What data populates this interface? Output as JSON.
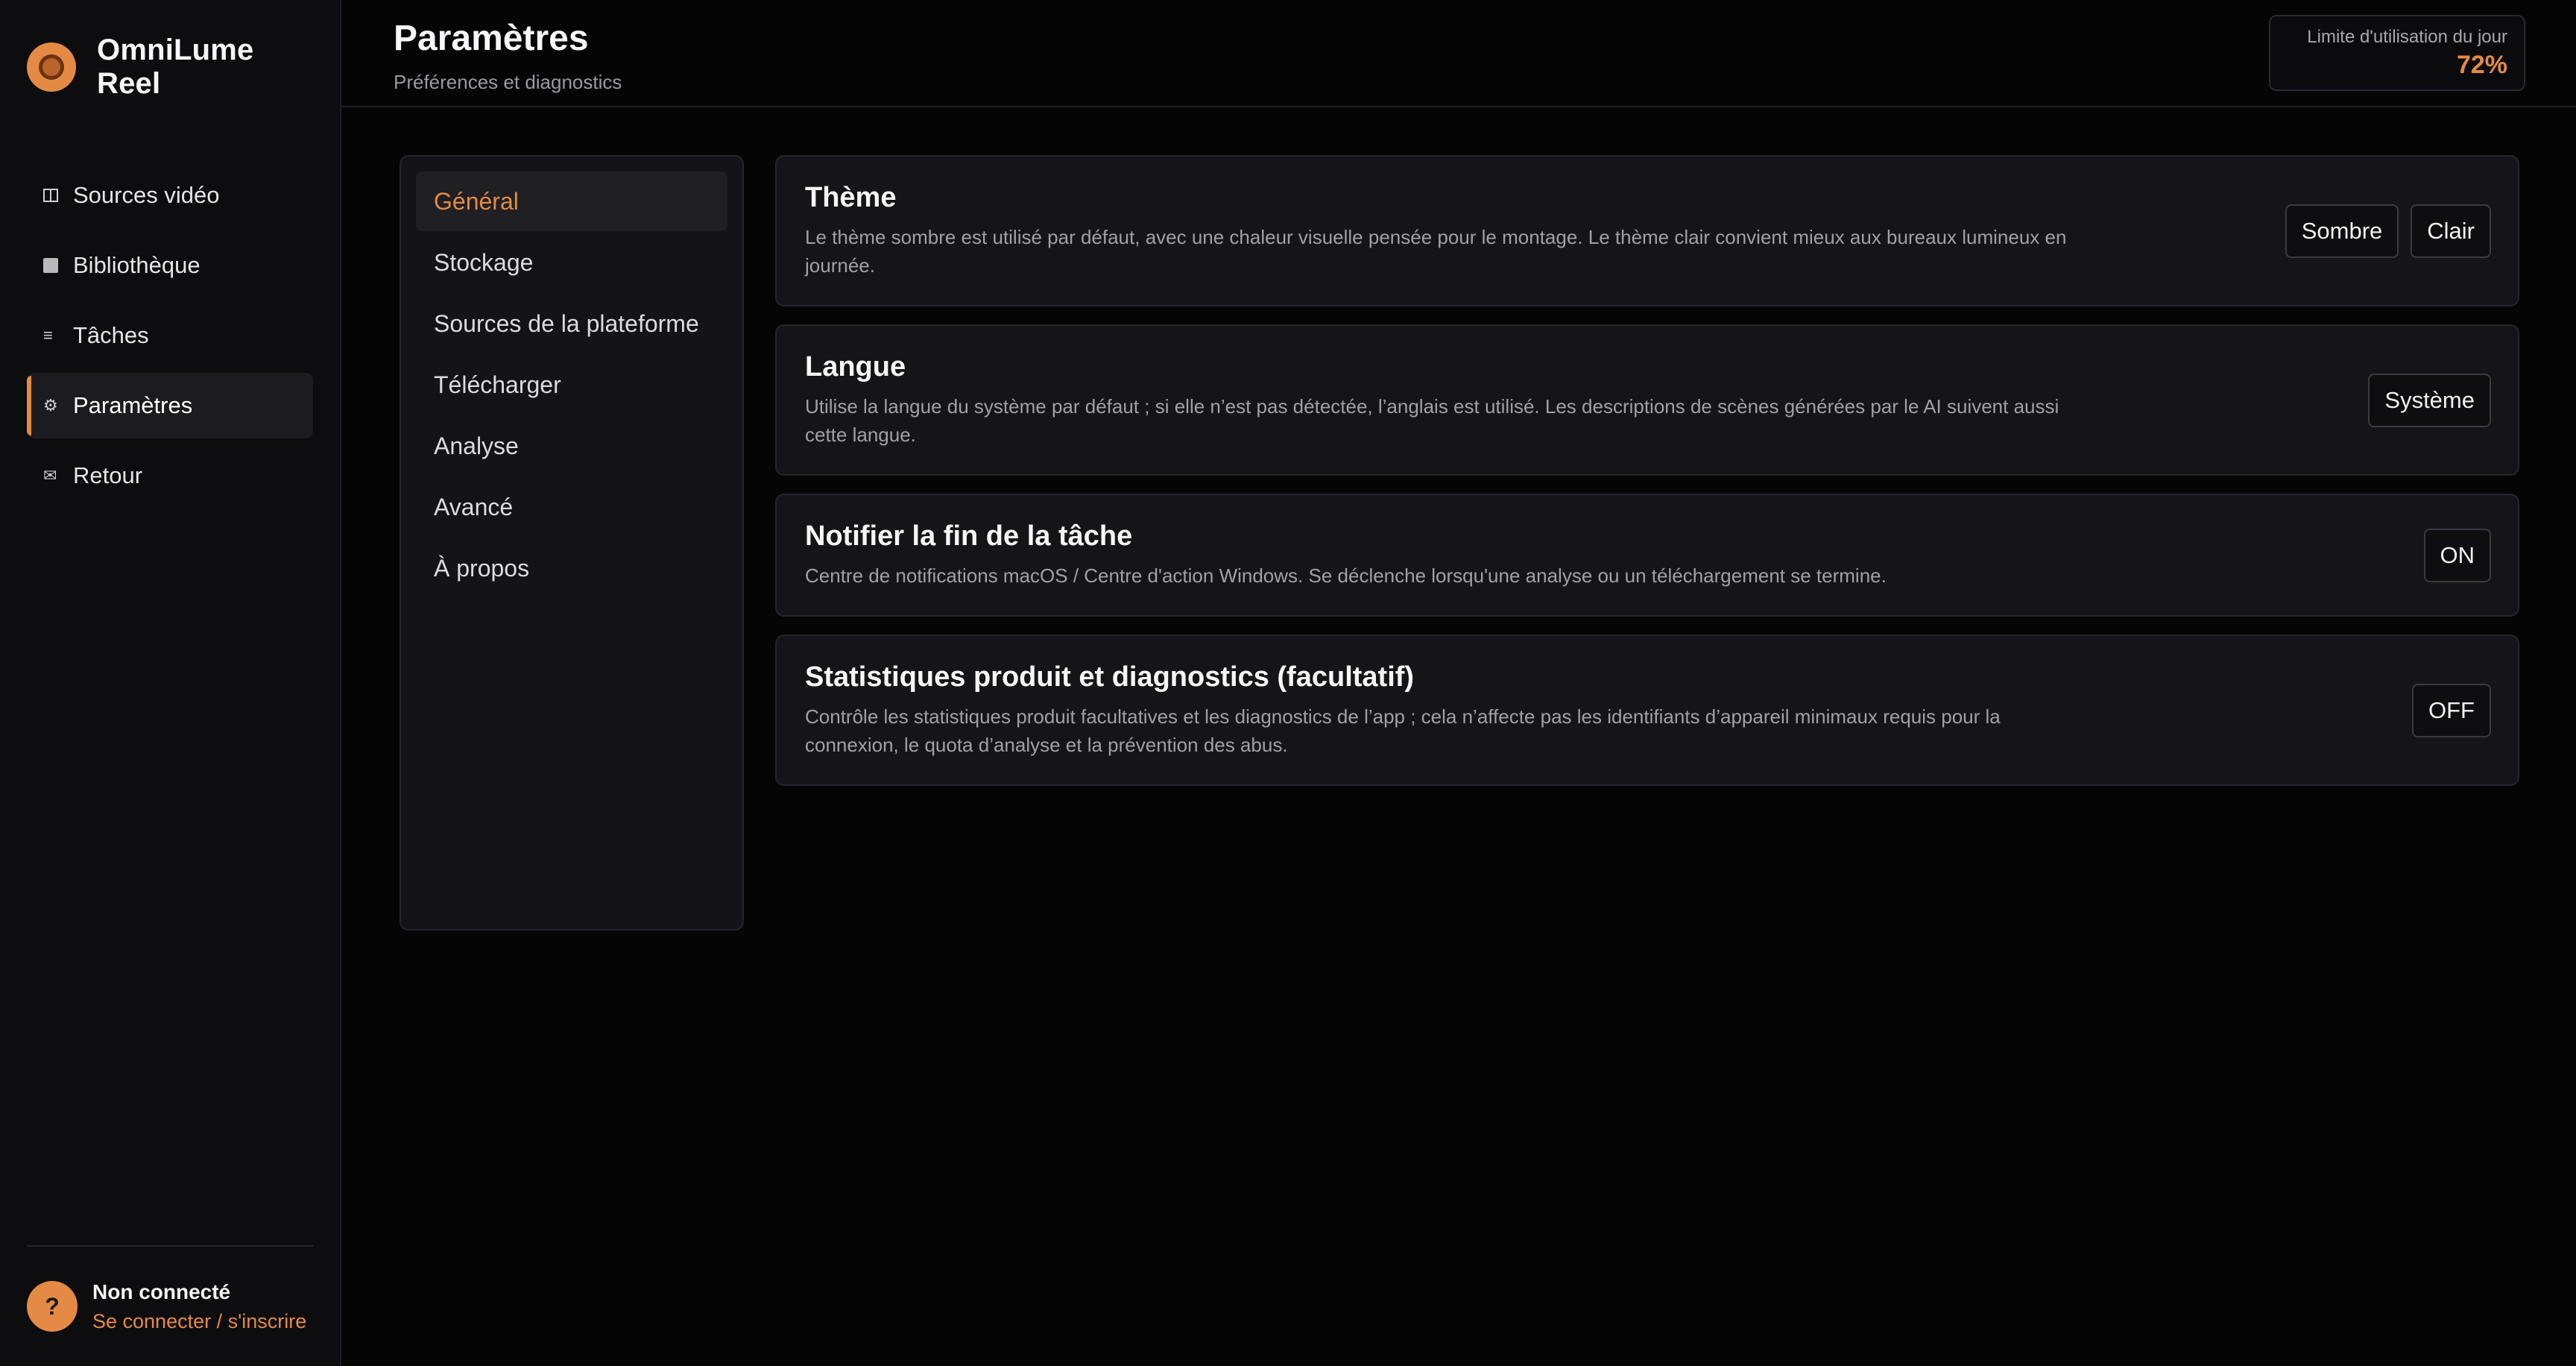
{
  "app": {
    "name": "OmniLume Reel"
  },
  "sidebar": {
    "items": [
      {
        "label": "Sources vidéo",
        "icon": "columns-icon"
      },
      {
        "label": "Bibliothèque",
        "icon": "square-icon"
      },
      {
        "label": "Tâches",
        "icon": "list-icon"
      },
      {
        "label": "Paramètres",
        "icon": "gear-icon"
      },
      {
        "label": "Retour",
        "icon": "mail-icon"
      }
    ],
    "active": "Paramètres",
    "account": {
      "avatar": "?",
      "status": "Non connecté",
      "link": "Se connecter / s'inscrire"
    }
  },
  "header": {
    "title": "Paramètres",
    "subtitle": "Préférences et diagnostics",
    "usage": {
      "label": "Limite d'utilisation du jour",
      "value": "72%"
    }
  },
  "settings_nav": {
    "items": [
      "Général",
      "Stockage",
      "Sources de la plateforme",
      "Télécharger",
      "Analyse",
      "Avancé",
      "À propos"
    ],
    "active": "Général"
  },
  "cards": {
    "theme": {
      "title": "Thème",
      "desc": "Le thème sombre est utilisé par défaut, avec une chaleur visuelle pensée pour le montage. Le thème clair convient mieux aux bureaux lumineux en journée.",
      "dark_label": "Sombre",
      "light_label": "Clair"
    },
    "language": {
      "title": "Langue",
      "desc": "Utilise la langue du système par défaut ; si elle n’est pas détectée, l’anglais est utilisé. Les descriptions de scènes générées par le AI suivent aussi cette langue.",
      "value": "Système"
    },
    "notify": {
      "title": "Notifier la fin de la tâche",
      "desc": "Centre de notifications macOS / Centre d'action Windows. Se déclenche lorsqu'une analyse ou un téléchargement se termine.",
      "value": "ON"
    },
    "stats": {
      "title": "Statistiques produit et diagnostics (facultatif)",
      "desc": "Contrôle les statistiques produit facultatives et les diagnostics de l’app ; cela n’affecte pas les identifiants d’appareil minimaux requis pour la connexion, le quota d’analyse et la prévention des abus.",
      "value": "OFF"
    }
  },
  "colors": {
    "accent": "#e58a44",
    "background": "#050506",
    "panel": "#151519"
  }
}
